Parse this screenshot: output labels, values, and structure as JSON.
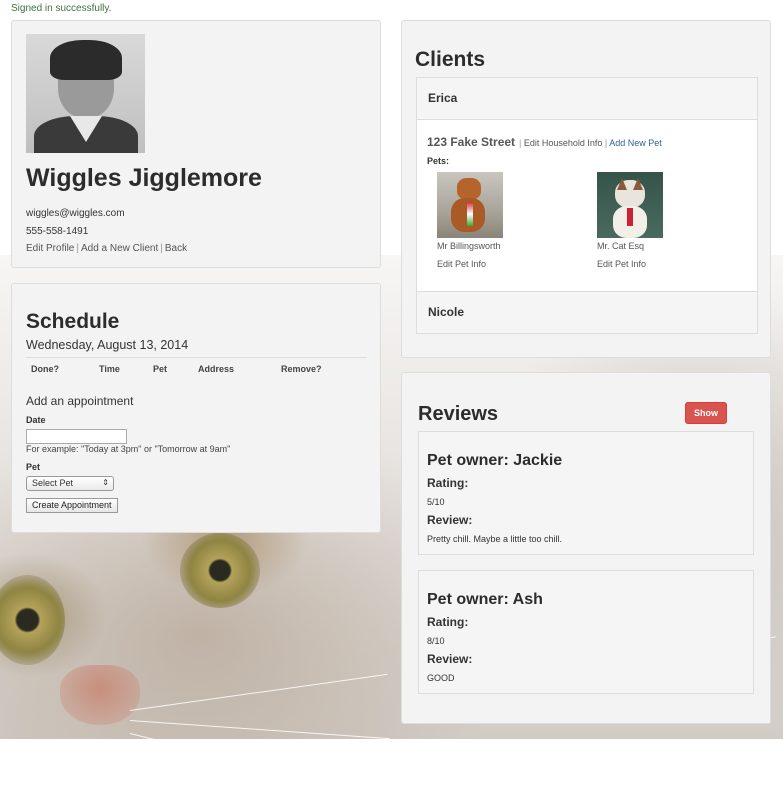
{
  "flash": "Signed in successfully.",
  "profile": {
    "name": "Wiggles Jigglemore",
    "email": "wiggles@wiggles.com",
    "phone": "555-558-1491",
    "links": [
      "Edit Profile",
      "Add a New Client",
      "Back"
    ],
    "separator": "|"
  },
  "schedule": {
    "title": "Schedule",
    "date": "Wednesday, August 13, 2014",
    "columns": [
      "Done?",
      "Time",
      "Pet",
      "Address",
      "Remove?"
    ],
    "add_title": "Add an appointment",
    "date_label": "Date",
    "date_value": "",
    "hint": "For example: \"Today at 3pm\" or \"Tomorrow at 9am\"",
    "pet_label": "Pet",
    "pet_select": "Select Pet",
    "create_button": "Create Appointment"
  },
  "clients": {
    "title": "Clients",
    "items": [
      {
        "name": "Erica",
        "address": "123 Fake Street",
        "edit_household": "Edit Household Info",
        "add_pet": "Add New Pet",
        "pets_label": "Pets:",
        "pets": [
          {
            "name": "Mr Billingsworth",
            "edit": "Edit Pet Info"
          },
          {
            "name": "Mr. Cat Esq",
            "edit": "Edit Pet Info"
          }
        ]
      },
      {
        "name": "Nicole"
      }
    ]
  },
  "reviews": {
    "title": "Reviews",
    "show_button": "Show",
    "items": [
      {
        "owner": "Pet owner: Jackie",
        "rating_label": "Rating:",
        "rating": "5/10",
        "review_label": "Review:",
        "text": "Pretty chill. Maybe a little too chill."
      },
      {
        "owner": "Pet owner: Ash",
        "rating_label": "Rating:",
        "rating": "8/10",
        "review_label": "Review:",
        "text": "GOOD"
      }
    ]
  },
  "colors": {
    "danger": "#d9534f",
    "link_blue": "#2a6496",
    "success": "#3c763d"
  }
}
